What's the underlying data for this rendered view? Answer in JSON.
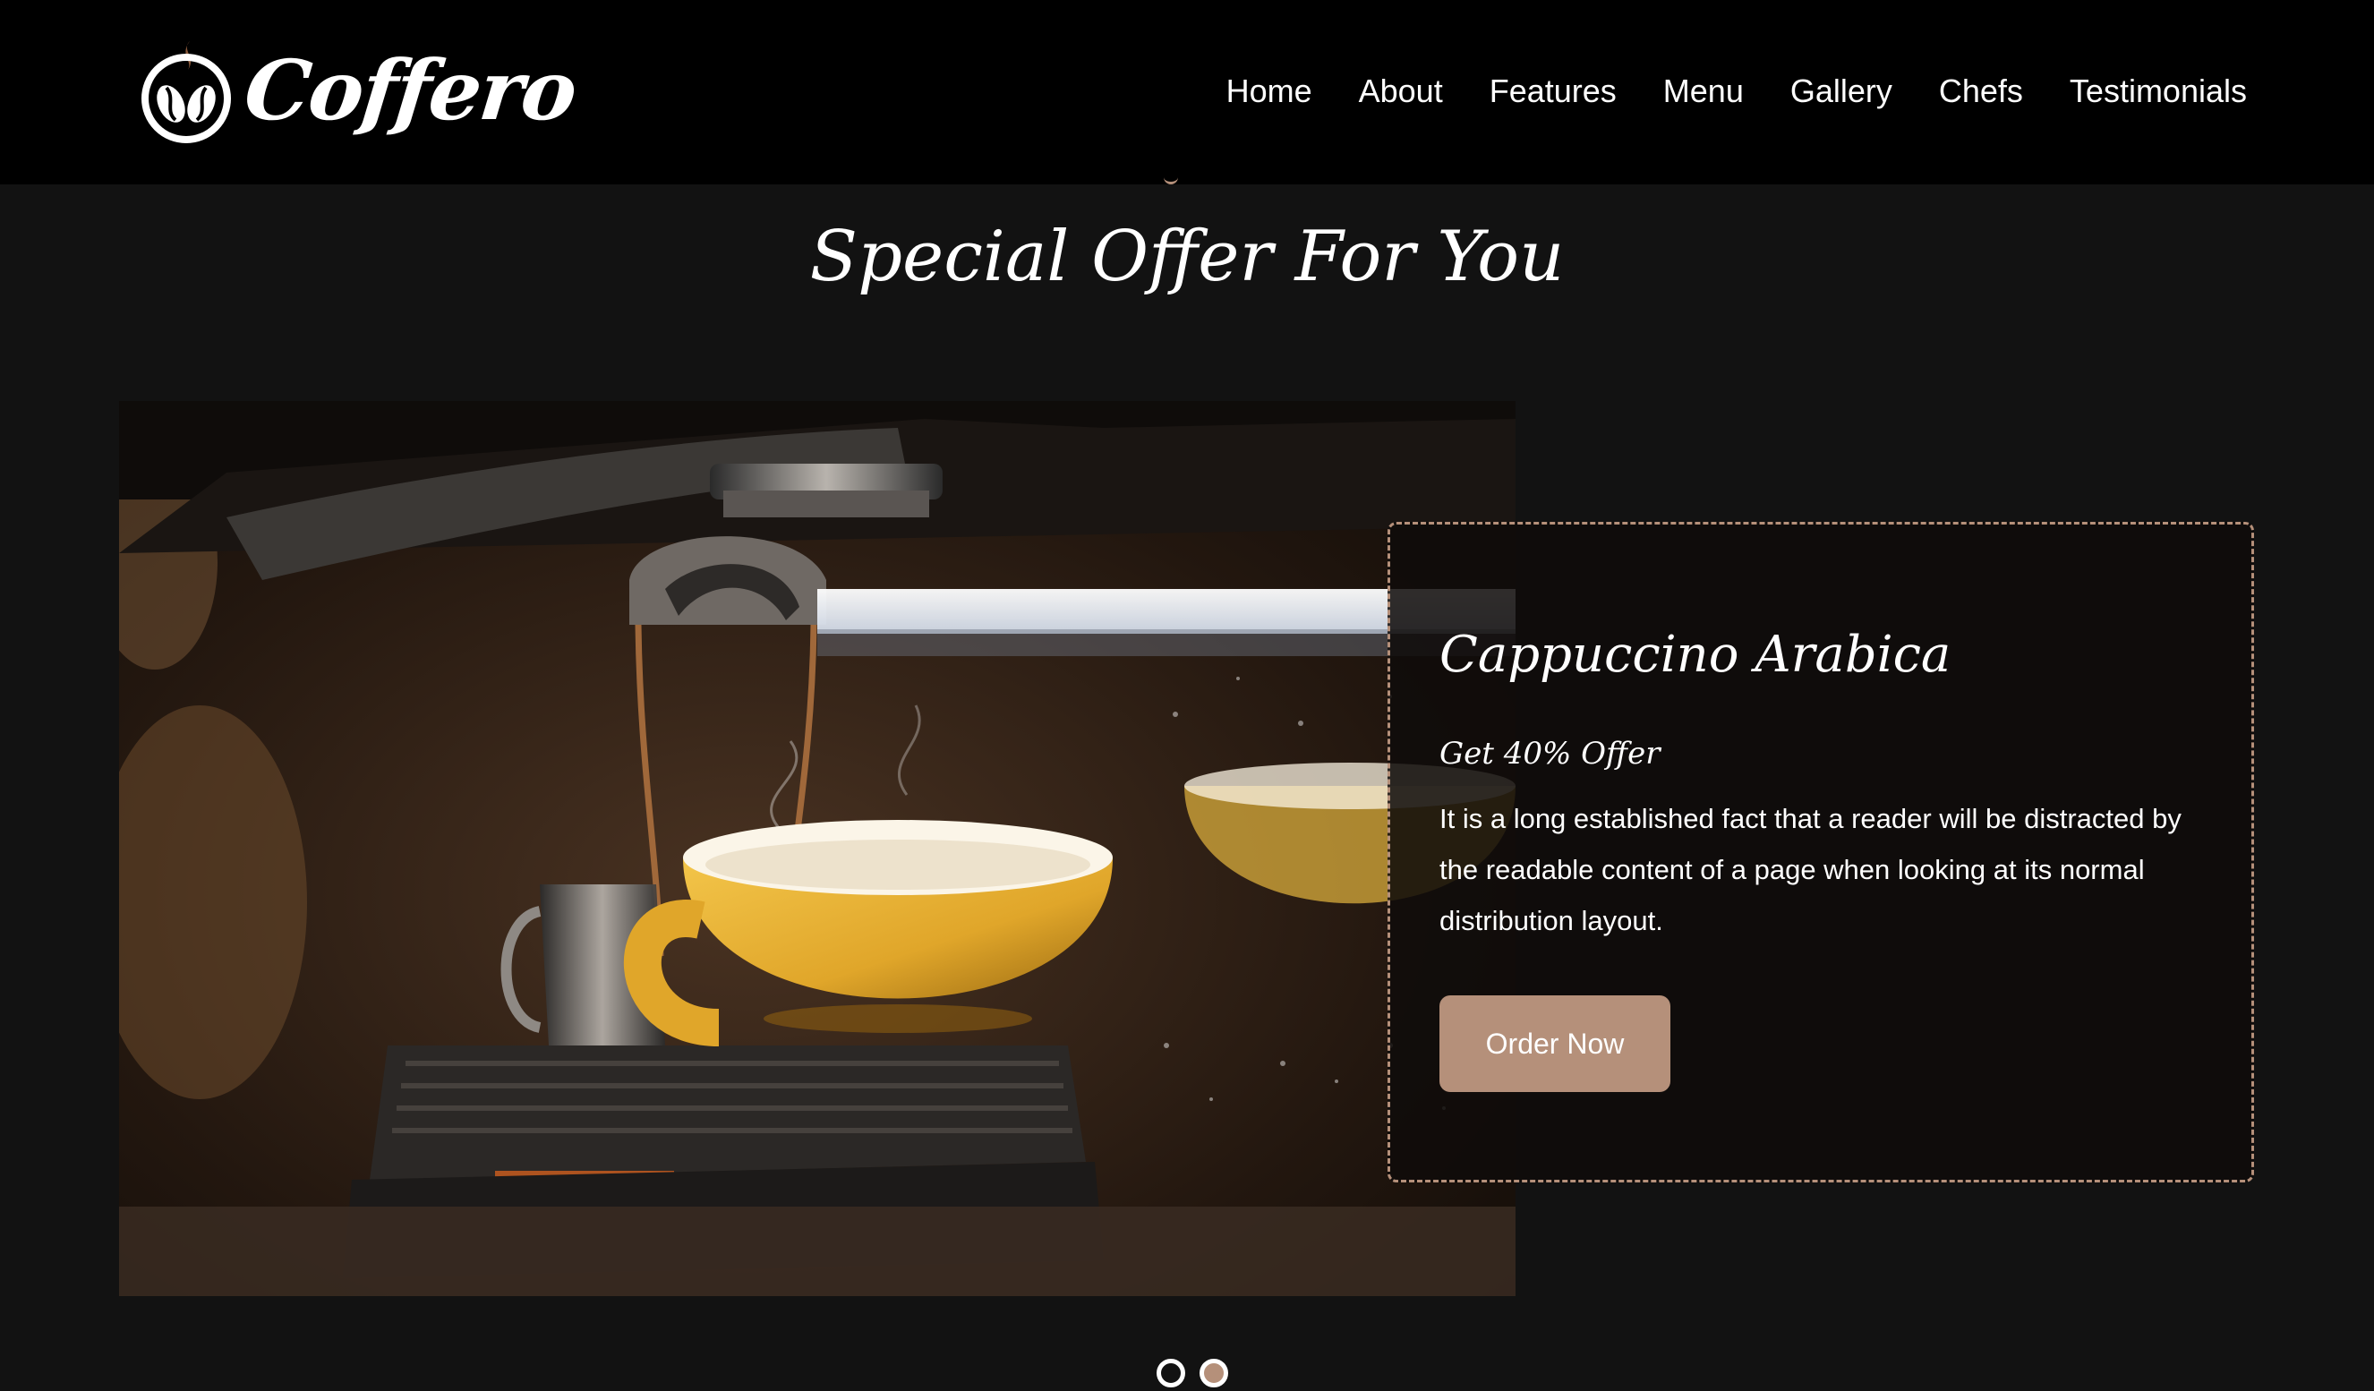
{
  "brand": {
    "name": "Coffero",
    "logo_icon": "coffee-beans-icon"
  },
  "nav": {
    "items": [
      {
        "label": "Home"
      },
      {
        "label": "About"
      },
      {
        "label": "Features"
      },
      {
        "label": "Menu"
      },
      {
        "label": "Gallery"
      },
      {
        "label": "Chefs"
      },
      {
        "label": "Testimonials"
      }
    ]
  },
  "offer_section": {
    "title": "Special Offer For You",
    "slide": {
      "name": "Cappuccino Arabica",
      "offer_text": "Get 40% Offer",
      "description": "It is a long established fact that a reader will be distracted by the readable content of a page when looking at its normal distribution layout.",
      "button_label": "Order Now",
      "image": "espresso-machine-yellow-cup-photo"
    },
    "carousel": {
      "slide_count": 2,
      "active_index": 1
    }
  },
  "colors": {
    "header_bg": "#000000",
    "page_bg": "#121212",
    "accent": "#b5907a",
    "text": "#ffffff"
  }
}
